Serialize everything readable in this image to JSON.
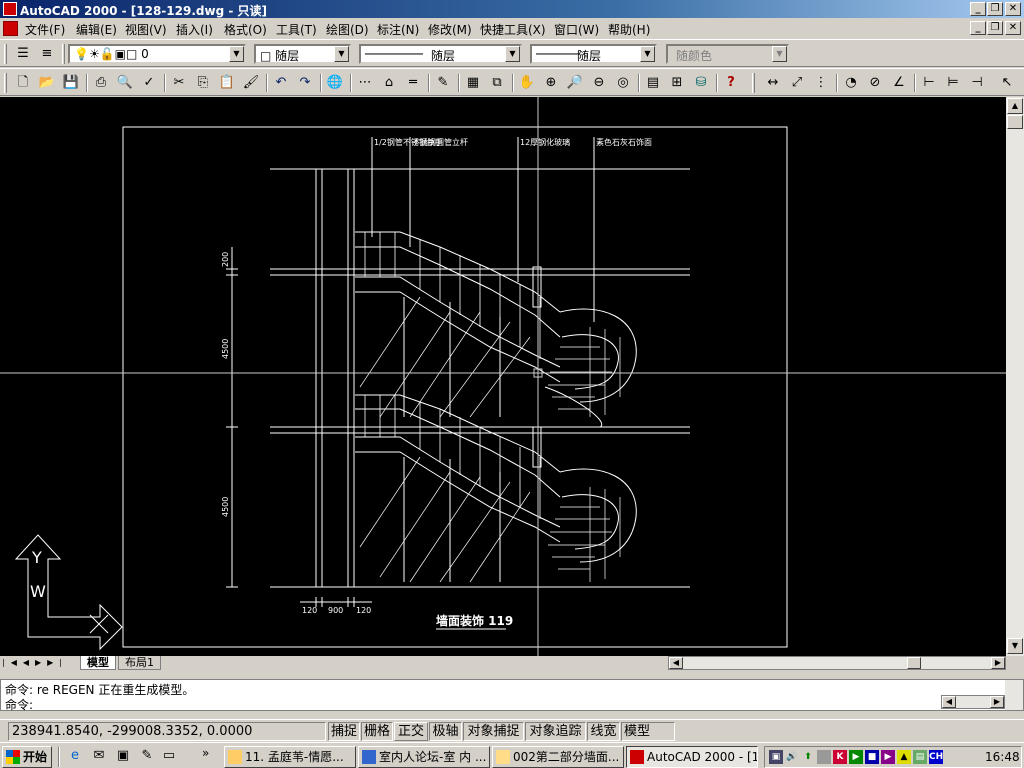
{
  "window": {
    "title": "AutoCAD 2000 - [128-129.dwg - 只读]",
    "title_buttons": [
      "_",
      "❐",
      "✕"
    ]
  },
  "menu": {
    "items": [
      "文件(F)",
      "编辑(E)",
      "视图(V)",
      "插入(I)",
      "格式(O)",
      "工具(T)",
      "绘图(D)",
      "标注(N)",
      "修改(M)",
      "快捷工具(X)",
      "窗口(W)",
      "帮助(H)"
    ]
  },
  "properties": {
    "layer_value": "0",
    "color_value": "随层",
    "linetype_value": "随层",
    "lineweight_value": "随层",
    "plotstyle_value": "随颜色"
  },
  "toolbar_icons": [
    "new-icon",
    "open-icon",
    "save-icon",
    "print-icon",
    "preview-icon",
    "spellcheck-icon",
    "cut-icon",
    "copy-icon",
    "paste-icon",
    "matchprop-icon",
    "undo-icon",
    "redo-icon",
    "hyperlink-icon",
    "tracking-icon",
    "ucs-icon",
    "distance-icon",
    "redraw-icon",
    "aerial-icon",
    "pan-icon",
    "zoom-realtime-icon",
    "zoom-window-icon",
    "zoom-previous-icon",
    "properties-icon",
    "designcenter-icon",
    "dbconnect-icon",
    "help-icon"
  ],
  "drawing": {
    "callouts": [
      "1/2钢管不锈钢扶手",
      "不锈钢圆管立杆",
      "12厚钢化玻璃",
      "素色石灰石饰面"
    ],
    "dims_vertical": [
      "200",
      "4500",
      "4500"
    ],
    "dims_horizontal": [
      "120",
      "900",
      "120"
    ],
    "caption": "墙面装饰 119",
    "ucs_labels": [
      "Y",
      "W"
    ]
  },
  "tabs": {
    "model": "模型",
    "layout1": "布局1"
  },
  "command": {
    "line1": "命令: re REGEN 正在重生成模型。",
    "line2": "命令:"
  },
  "status": {
    "coords": "238941.8540, -299008.3352, 0.0000",
    "toggles": [
      "捕捉",
      "栅格",
      "正交",
      "极轴",
      "对象捕捉",
      "对象追踪",
      "线宽",
      "模型"
    ]
  },
  "taskbar": {
    "start": "开始",
    "items": [
      "11. 孟庭苇-情愿...",
      "室内人论坛-室 内 ...",
      "002第二部分墙面...",
      "AutoCAD 2000 - [1..."
    ],
    "tray_ch": "CH",
    "clock": "16:48"
  },
  "colors": {
    "title_blue": "#0a246a",
    "canvas": "#000000",
    "chrome": "#d4d0c8"
  }
}
